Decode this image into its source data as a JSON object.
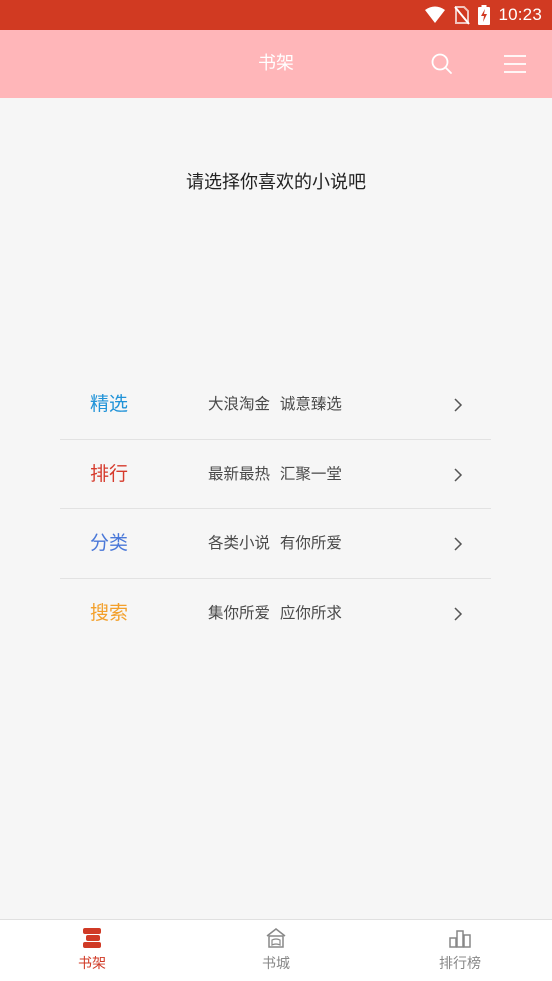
{
  "status": {
    "time": "10:23"
  },
  "header": {
    "title": "书架",
    "search_icon": "search-icon",
    "menu_icon": "menu-icon"
  },
  "prompt": "请选择你喜欢的小说吧",
  "menu": [
    {
      "title": "精选",
      "desc": "大浪淘金  诚意臻选",
      "color": "#2193d8"
    },
    {
      "title": "排行",
      "desc": "最新最热  汇聚一堂",
      "color": "#d63a2c"
    },
    {
      "title": "分类",
      "desc": "各类小说  有你所爱",
      "color": "#4a78d8"
    },
    {
      "title": "搜索",
      "desc": "集你所爱  应你所求",
      "color": "#f3a02b"
    }
  ],
  "bottom_nav": [
    {
      "label": "书架",
      "icon": "bookshelf-icon",
      "active": true
    },
    {
      "label": "书城",
      "icon": "bookstore-icon",
      "active": false
    },
    {
      "label": "排行榜",
      "icon": "ranking-icon",
      "active": false
    }
  ],
  "colors": {
    "status_bar": "#d13a22",
    "app_bar": "#ffb6b9",
    "active_nav": "#d03a26"
  }
}
